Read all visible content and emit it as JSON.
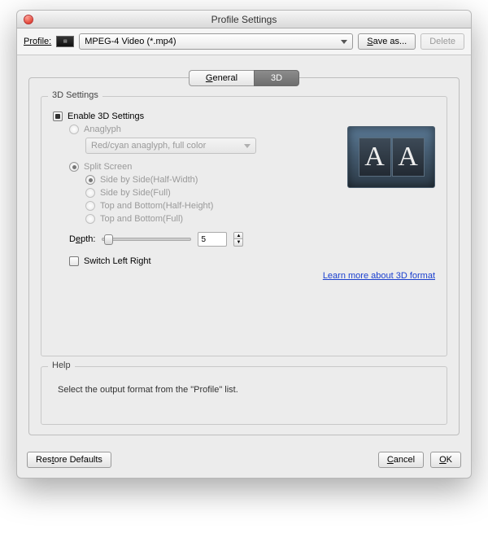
{
  "window": {
    "title": "Profile Settings"
  },
  "toolbar": {
    "profile_label": "Profile:",
    "profile_value": "MPEG-4 Video (*.mp4)",
    "save_as": "Save as...",
    "delete": "Delete"
  },
  "tabs": {
    "general": "General",
    "three_d": "3D"
  },
  "settings": {
    "group_title": "3D Settings",
    "enable_label": "Enable 3D Settings",
    "anaglyph_label": "Anaglyph",
    "anaglyph_option": "Red/cyan anaglyph, full color",
    "split_label": "Split Screen",
    "options": {
      "sbs_half": "Side by Side(Half-Width)",
      "sbs_full": "Side by Side(Full)",
      "tb_half": "Top and Bottom(Half-Height)",
      "tb_full": "Top and Bottom(Full)"
    },
    "depth_label": "Depth:",
    "depth_value": "5",
    "switch_label": "Switch Left Right",
    "learn_more": "Learn more about 3D format",
    "preview_glyph": "A"
  },
  "help": {
    "title": "Help",
    "text": "Select the output format from the \"Profile\" list."
  },
  "buttons": {
    "restore": "Restore Defaults",
    "cancel": "Cancel",
    "ok": "OK"
  }
}
